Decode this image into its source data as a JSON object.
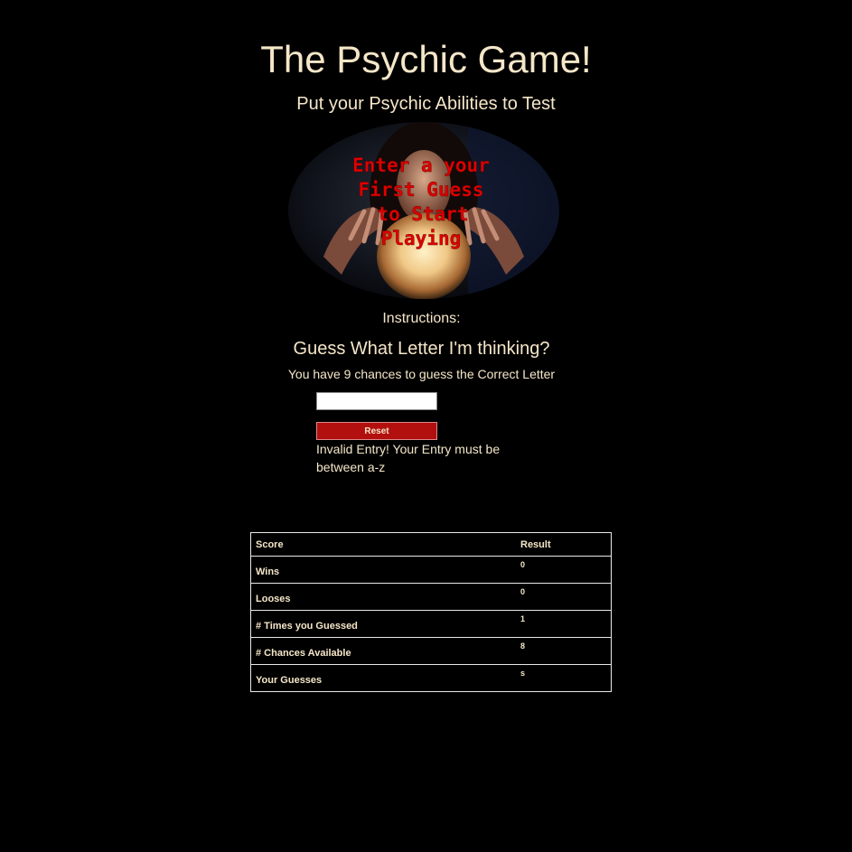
{
  "header": {
    "title": "The Psychic Game!",
    "subtitle": "Put your Psychic Abilities to Test"
  },
  "crystal_ball": {
    "overlay_lines": [
      "Enter a your",
      "First Guess",
      "to Start",
      "Playing"
    ],
    "overlay_color": "#e00000"
  },
  "instructions": {
    "label": "Instructions:",
    "question": "Guess What Letter I'm thinking?",
    "chances_text": "You have 9 chances to guess the Correct Letter"
  },
  "form": {
    "guess_value": "",
    "reset_label": "Reset",
    "error_message": "Invalid Entry! Your Entry must be between a-z"
  },
  "score_table": {
    "headers": [
      "Score",
      "Result"
    ],
    "rows": [
      {
        "label": "Wins",
        "value": "0"
      },
      {
        "label": "Looses",
        "value": "0"
      },
      {
        "label": "# Times you Guessed",
        "value": "1"
      },
      {
        "label": "# Chances Available",
        "value": "8"
      },
      {
        "label": "Your Guesses",
        "value": "s"
      }
    ]
  },
  "colors": {
    "background": "#000000",
    "text": "#f5e6c8",
    "reset_button": "#b20f0f"
  }
}
